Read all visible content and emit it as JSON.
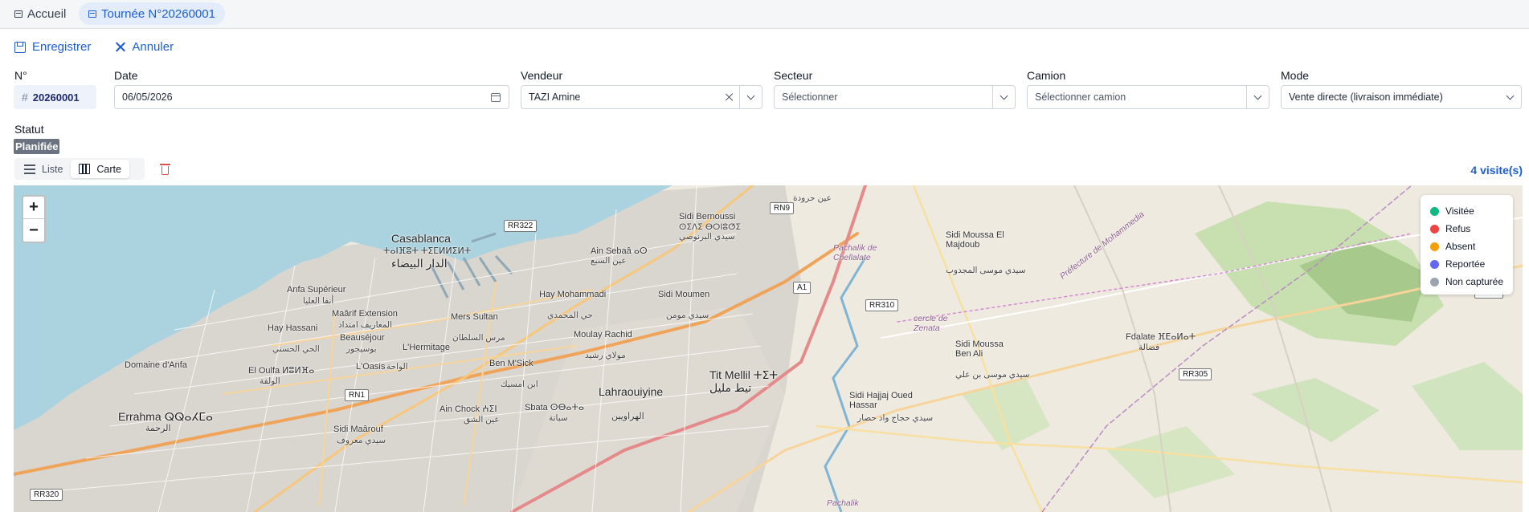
{
  "tabs": [
    {
      "label": "Accueil"
    },
    {
      "label": "Tournée N°20260001"
    }
  ],
  "toolbar": {
    "save_label": "Enregistrer",
    "cancel_label": "Annuler"
  },
  "form": {
    "number": {
      "label": "N°",
      "value": "20260001"
    },
    "date": {
      "label": "Date",
      "value": "06/05/2026"
    },
    "vendeur": {
      "label": "Vendeur",
      "value": "TAZI Amine"
    },
    "secteur": {
      "label": "Secteur",
      "placeholder": "Sélectionner"
    },
    "camion": {
      "label": "Camion",
      "placeholder": "Sélectionner camion"
    },
    "mode": {
      "label": "Mode",
      "value": "Vente directe (livraison immédiate)"
    }
  },
  "status": {
    "label": "Statut",
    "value": "Planifiée",
    "color": "#6b7280"
  },
  "view": {
    "list_label": "Liste",
    "map_label": "Carte",
    "active": "Carte"
  },
  "visits_count": "4 visite(s)",
  "map": {
    "zoom_in": "+",
    "zoom_out": "−",
    "labels": {
      "casablanca": "Casablanca",
      "casablanca_tif": "ⵜⴰⵏⴼⵓⵜ ⵜⵉⵎⵍⵍⵉⵍⵜ",
      "casablanca_ar": "الدار البيضاء",
      "sidi_bernoussi": "Sidi Bernoussi",
      "sidi_bernoussi_tif": "ⵙⵉⴷⵉ ⴱⵔⵏⵓⵚⵉ",
      "sidi_bernoussi_ar": "سيدي البرنوصي",
      "ain_sebaa": "Ain Sebaâ ⴰⵙ",
      "ain_sebaa_ar": "عين السبع",
      "anfa_superieur": "Anfa Supérieur",
      "anfa_superieur_ar": "أنفا العليا",
      "maarif": "Maârif Extension",
      "maarif_ar": "المعاريف امتداد",
      "hay_mohammadi": "Hay Mohammadi",
      "hay_mohammadi_ar": "حي المحمدي",
      "sidi_moumen": "Sidi Moumen",
      "sidi_moumen_ar": "سيدي مومن",
      "mers_sultan": "Mers Sultan",
      "mers_sultan_ar": "مرس السلطان",
      "hay_hassani": "Hay Hassani",
      "hay_hassani_ar": "الحي الحسني",
      "beausejour": "Beauséjour",
      "beausejour_ar": "بوسيجور",
      "hermitage": "L'Hermitage",
      "moulay_rachid": "Moulay Rachid",
      "moulay_rachid_ar": "مولاي رشيد",
      "domaine_anfa": "Domaine d'Anfa",
      "oulfa": "El Oulfa ⵍⵓⵍⴼⴰ",
      "oulfa_ar": "الولفة",
      "oasis": "L'Oasis",
      "oasis_ar": "الواحة",
      "ben_msick": "Ben M'Sick",
      "ben_msick_ar": "ابن امسيك",
      "tit_mellil": "Tit Mellil ⵜⵉⵜ",
      "tit_mellil_ar": "تيط مليل",
      "lahraouiyine": "Lahraouiyine",
      "lahraouiyine_ar": "الهراويين",
      "errahma": "Errahma ⵕⵕⴰⵃⵎⴰ",
      "errahma_ar": "الرحمة",
      "ain_chock": "Ain Chock ⵄⵉⵏ",
      "ain_chock_ar": "عين الشق",
      "sbata": "Sbata ⵙⴱⴰⵜⴰ",
      "sbata_ar": "سباتة",
      "sidi_maarouf": "Sidi Maârouf",
      "sidi_maarouf_ar": "سيدي معروف",
      "sidi_moussa_majdoub": "Sidi Moussa El Majdoub",
      "sidi_moussa_majdoub_ar": "سيدي موسى المجدوب",
      "sidi_moussa_ben_ali": "Sidi Moussa Ben Ali",
      "sidi_moussa_ben_ali_ar": "سيدي موسى بن علي",
      "fdalate": "Fdalate ⴼⴹⴰⵍⴰⵜ",
      "fdalate_ar": "فضالة",
      "sidi_hajjaj": "Sidi Hajjaj Oued Hassar",
      "sidi_hajjaj_ar": "سيدي حجاج واد حصار",
      "pachalik_chellalate": "Pachalik de Chellalate",
      "cercle_zenata": "cercle de Zenata",
      "ain_harrouda_ar": "عين حرودة",
      "pachalik": "Pachalik",
      "prefecture": "Préfecture de Mohammedia"
    },
    "roads": [
      "RR322",
      "RN9",
      "A1",
      "RR310",
      "RR305",
      "RN23",
      "RN1",
      "RR320"
    ],
    "legend": [
      {
        "label": "Visitée",
        "color": "#10b981"
      },
      {
        "label": "Refus",
        "color": "#ef4444"
      },
      {
        "label": "Absent",
        "color": "#f59e0b"
      },
      {
        "label": "Reportée",
        "color": "#6366f1"
      },
      {
        "label": "Non capturée",
        "color": "#9ca3af"
      }
    ]
  }
}
